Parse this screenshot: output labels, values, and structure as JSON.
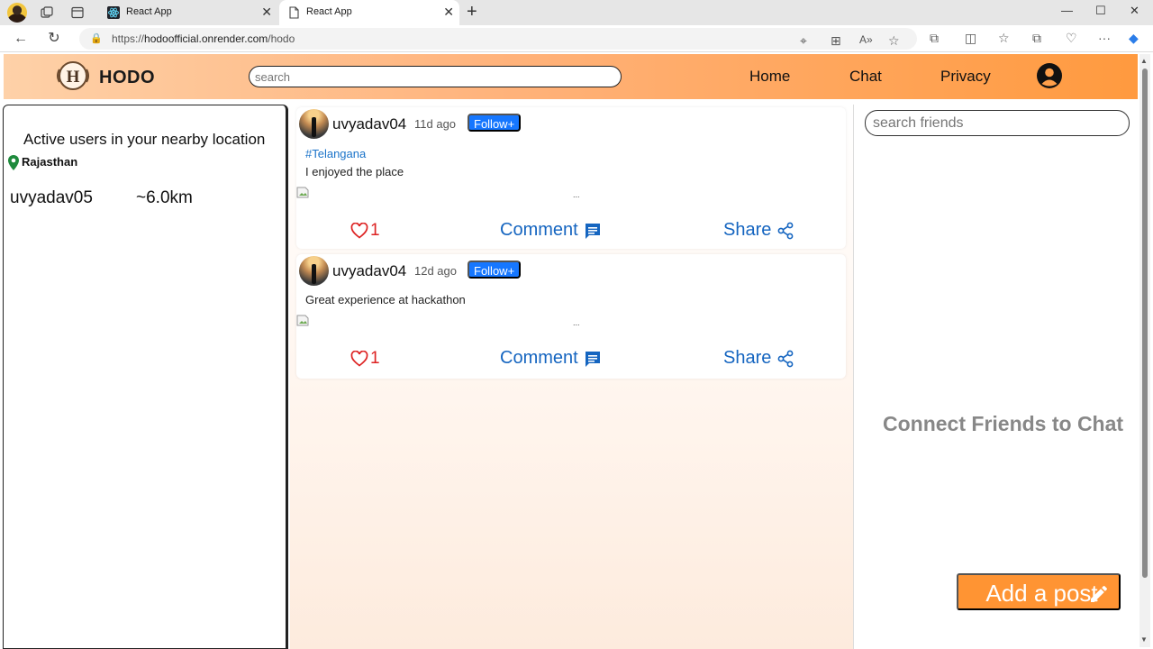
{
  "browser": {
    "tabs": [
      {
        "title": "React App",
        "active": false
      },
      {
        "title": "React App",
        "active": true
      }
    ],
    "url_prefix": "https://",
    "url_host": "hodoofficial.onrender.com",
    "url_path": "/hodo"
  },
  "header": {
    "brand": "HODO",
    "search_placeholder": "search",
    "nav": [
      "Home",
      "Chat",
      "Privacy"
    ]
  },
  "left_panel": {
    "title": "Active users in your nearby location",
    "location": "Rajasthan",
    "users": [
      {
        "name": "uvyadav05",
        "distance": "~6.0km"
      }
    ]
  },
  "posts": [
    {
      "user": "uvyadav04",
      "time": "11d ago",
      "follow_label": "Follow+",
      "tag": "#Telangana",
      "text": "I enjoyed the place",
      "image_alt": "...",
      "likes": "1",
      "comment_label": "Comment",
      "share_label": "Share"
    },
    {
      "user": "uvyadav04",
      "time": "12d ago",
      "follow_label": "Follow+",
      "tag": "",
      "text": "Great experience at hackathon",
      "image_alt": "...",
      "likes": "1",
      "comment_label": "Comment",
      "share_label": "Share"
    }
  ],
  "right_panel": {
    "search_placeholder": "search friends",
    "empty_message": "Connect Friends to Chat",
    "add_post_label": "Add a post"
  },
  "colors": {
    "header_gradient_start": "#fed1a8",
    "header_gradient_end": "#ff9a3f",
    "accent_orange": "#ff9433",
    "follow_blue": "#1677ff",
    "action_blue": "#1565c0",
    "like_red": "#d22222"
  }
}
